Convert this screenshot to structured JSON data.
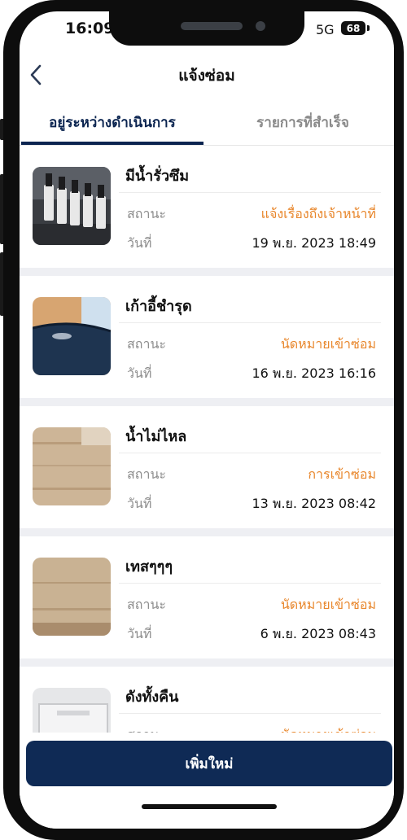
{
  "status_bar": {
    "time": "16:09",
    "network": "5G",
    "battery": "68"
  },
  "header": {
    "title": "แจ้งซ่อม"
  },
  "tabs": [
    {
      "label": "อยู่ระหว่างดำเนินการ",
      "active": true
    },
    {
      "label": "รายการที่สำเร็จ",
      "active": false
    }
  ],
  "list": {
    "status_label": "สถานะ",
    "date_label": "วันที่",
    "status_color": "#e8862b",
    "items": [
      {
        "title": "มีน้ำรั่วซึม",
        "status": "แจ้งเรื่องถึงเจ้าหน้าที่",
        "date": "19 พ.ย. 2023 18:49",
        "thumbnail": "coffee-grinders-photo"
      },
      {
        "title": "เก้าอี้ชำรุด",
        "status": "นัดหมายเข้าซ่อม",
        "date": "16 พ.ย. 2023 16:16",
        "thumbnail": "damaged-chair-photo"
      },
      {
        "title": "น้ำไม่ไหล",
        "status": "การเข้าซ่อม",
        "date": "13 พ.ย. 2023 08:42",
        "thumbnail": "wood-surface-photo"
      },
      {
        "title": "เทสๆๆๆ",
        "status": "นัดหมายเข้าซ่อม",
        "date": "6 พ.ย. 2023 08:43",
        "thumbnail": "wood-surface-photo"
      },
      {
        "title": "ดังทั้งคืน",
        "status": "นัดหมายเข้าซ่อม",
        "date": "",
        "thumbnail": "device-photo"
      }
    ]
  },
  "footer": {
    "add_label": "เพิ่มใหม่"
  },
  "colors": {
    "primary": "#0f2a55",
    "accent": "#e8862b"
  }
}
